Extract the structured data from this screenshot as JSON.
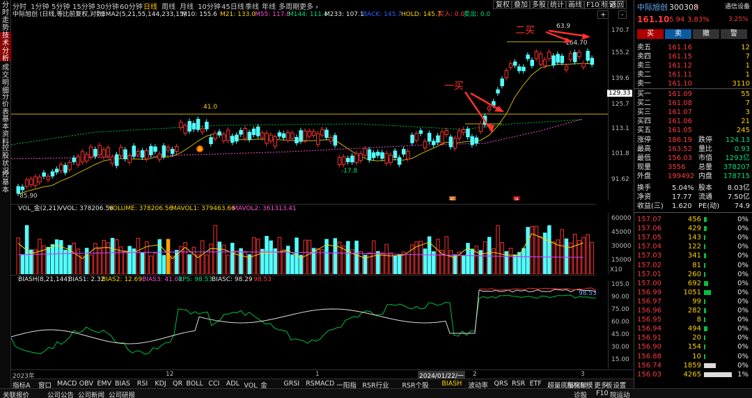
{
  "left_tabs": [
    "分时走势",
    "技术分析",
    "成交明细",
    "分价表",
    "基本资料",
    "控股状况",
    "控基本"
  ],
  "periods": [
    "分时",
    "1分钟",
    "5分钟",
    "15分钟",
    "30分钟",
    "60分钟",
    "日线",
    "周线",
    "月线",
    "10分钟",
    "45日线",
    "季线",
    "年线",
    "多周期",
    "更多 ›"
  ],
  "active_period": "日线",
  "right_buttons": [
    "复权",
    "叠加",
    "多股",
    "统计",
    "画线",
    "F10",
    "标记",
    "-",
    "+",
    "返回"
  ],
  "main_indicator": {
    "title": "中际旭创 (日线,等比前复权,对数)",
    "ema": "EMA2(5,21,55,144,233,15)",
    "m10": "M10: 155.6",
    "m21": "M21: 133.0",
    "m55": "M55: 117.8",
    "m144": "M144: 111.4",
    "m233": "M233: 107.1",
    "back": "BACK: 145.7",
    "hold": "HOLD: 145.7",
    "buy": "买入: 0.0",
    "sell": "卖出: 0.0"
  },
  "main_axis": [
    "170.7",
    "155.2",
    "139.6",
    "125.7",
    "113.1",
    "101.8",
    "91.62"
  ],
  "price_tag": "129.33",
  "annotations": {
    "buy1": "一买",
    "buy2": "二买",
    "hi1": "63.9",
    "hi2": "164.70",
    "p41": "41.0",
    "p178": "-17.8",
    "p8590": "85.90",
    "flag1": "预",
    "flag2": "涨"
  },
  "vol_indicator": {
    "title": "VOL_金(2,21)",
    "vvol": "VVOL: 378206.56",
    "volume": "VOLUME: 378206.56",
    "mavol1": "MAVOL1: 379463.66",
    "mavol2": "MAVOL2: 361313.41"
  },
  "vol_axis": [
    "60000",
    "45000",
    "30000",
    "15000",
    "X10"
  ],
  "bias_indicator": {
    "title": "BIASH(8,21,144)",
    "b1": "BIAS1: 2.32",
    "b2": "BIAS2: 12.69",
    "b3": "BIAS3: 41.01",
    "rps": "RPS: 98.53",
    "biasc": "BIASC: 98.29",
    "neg": "- 98.53"
  },
  "bias_axis": [
    "105.0",
    "90.00",
    "75.00",
    "60.00",
    "45.00",
    "30.00",
    "15.00"
  ],
  "bias_tag": "98.53",
  "xaxis": {
    "y2023": "2023年",
    "m12": "12",
    "m1": "1",
    "date": "2024/01/22/一",
    "m2": "2",
    "m3": "3"
  },
  "bottom_tabs": [
    "指标A",
    "窗口",
    "MACD",
    "OBV",
    "EMV",
    "BIAS",
    "RSI",
    "KDJ",
    "QR",
    "BOLL",
    "CCI",
    "ADL",
    "VOL_金",
    "GRSI",
    "RSMACD",
    "一阳指",
    "RSR行业",
    "RSR个股",
    "BIASH",
    "波动率",
    "QRS",
    "RSR",
    "ETF",
    "超量底部突破",
    "更多",
    "设置"
  ],
  "bottom_right": [
    "指标B",
    "模",
    "板"
  ],
  "right_panel": {
    "name": "中际旭创",
    "code": "300308",
    "badge": "R",
    "link": "通信设备",
    "price": "161.10",
    "chg": "5.94",
    "pct": "3.83%",
    "pct2": "3.25%",
    "trade_buttons": [
      "买",
      "卖",
      "撤",
      "警"
    ],
    "asks": [
      {
        "label": "卖五",
        "price": "161.16",
        "vol": "12"
      },
      {
        "label": "卖四",
        "price": "161.15",
        "vol": "7"
      },
      {
        "label": "卖三",
        "price": "161.12",
        "vol": "1"
      },
      {
        "label": "卖二",
        "price": "161.11",
        "vol": "1"
      },
      {
        "label": "卖一",
        "price": "161.10",
        "vol": "3110"
      }
    ],
    "bids": [
      {
        "label": "买一",
        "price": "161.09",
        "vol": "55"
      },
      {
        "label": "买二",
        "price": "161.08",
        "vol": "7"
      },
      {
        "label": "买三",
        "price": "161.07",
        "vol": "3"
      },
      {
        "label": "买四",
        "price": "161.06",
        "vol": "21"
      },
      {
        "label": "买五",
        "price": "161.05",
        "vol": "245"
      }
    ],
    "stats": [
      {
        "l1": "涨停",
        "v1": "186.19",
        "l2": "跌停",
        "v2": "124.13"
      },
      {
        "l1": "最高",
        "v1": "163.52",
        "l2": "量比",
        "v2": "0.93"
      },
      {
        "l1": "最低",
        "v1": "156.03",
        "l2": "市值",
        "v2": "1293亿"
      },
      {
        "l1": "现量",
        "v1": "3556",
        "l2": "总量",
        "v2": "378207"
      },
      {
        "l1": "外盘",
        "v1": "199492",
        "l2": "内盘",
        "v2": "178715"
      }
    ],
    "stats2": [
      {
        "l1": "换手",
        "v1": "5.04%",
        "l2": "股本",
        "v2": "8.03亿"
      },
      {
        "l1": "净资",
        "v1": "17.77",
        "l2": "流通",
        "v2": "7.50亿"
      },
      {
        "l1": "收益(三)",
        "v1": "1.620",
        "l2": "PE(动)",
        "v2": "74.9"
      }
    ],
    "depth": [
      {
        "p": "157.07",
        "v": "456",
        "pct": "0%"
      },
      {
        "p": "157.06",
        "v": "429",
        "pct": "0%"
      },
      {
        "p": "157.05",
        "v": "143",
        "pct": "0%"
      },
      {
        "p": "157.04",
        "v": "122",
        "pct": "0%"
      },
      {
        "p": "157.03",
        "v": "341",
        "pct": "0%"
      },
      {
        "p": "157.02",
        "v": "81",
        "pct": "0%"
      },
      {
        "p": "157.01",
        "v": "260",
        "pct": "0%"
      },
      {
        "p": "157.00",
        "v": "692",
        "pct": "0%"
      },
      {
        "p": "156.99",
        "v": "1051",
        "pct": "0%"
      },
      {
        "p": "156.97",
        "v": "99",
        "pct": "0%"
      },
      {
        "p": "156.96",
        "v": "282",
        "pct": "0%"
      },
      {
        "p": "156.95",
        "v": "8",
        "pct": "0%"
      },
      {
        "p": "156.94",
        "v": "494",
        "pct": "0%"
      },
      {
        "p": "156.91",
        "v": "20",
        "pct": "0%"
      },
      {
        "p": "156.90",
        "v": "154",
        "pct": "0%"
      },
      {
        "p": "156.88",
        "v": "10",
        "pct": "0%"
      },
      {
        "p": "156.74",
        "v": "1859",
        "pct": "0%"
      },
      {
        "p": "156.03",
        "v": "4265",
        "pct": "1%"
      }
    ]
  },
  "status_left": [
    "关联报价",
    "公司公告",
    "公司新闻",
    "公司研报"
  ],
  "status_right": [
    "诊股",
    "F10",
    "院运动"
  ]
}
